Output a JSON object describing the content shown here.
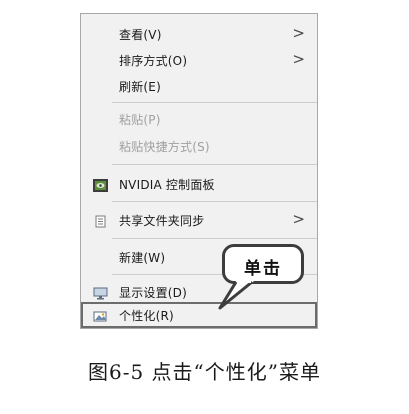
{
  "context_menu": {
    "items": [
      {
        "label": "查看(V)",
        "has_submenu": true,
        "disabled": false,
        "icon": ""
      },
      {
        "label": "排序方式(O)",
        "has_submenu": true,
        "disabled": false,
        "icon": ""
      },
      {
        "label": "刷新(E)",
        "has_submenu": false,
        "disabled": false,
        "icon": ""
      },
      {
        "label": "粘贴(P)",
        "has_submenu": false,
        "disabled": true,
        "icon": ""
      },
      {
        "label": "粘贴快捷方式(S)",
        "has_submenu": false,
        "disabled": true,
        "icon": ""
      },
      {
        "label": "NVIDIA 控制面板",
        "has_submenu": false,
        "disabled": false,
        "icon": "nvidia-icon"
      },
      {
        "label": "共享文件夹同步",
        "has_submenu": true,
        "disabled": false,
        "icon": "share-sync-icon"
      },
      {
        "label": "新建(W)",
        "has_submenu": true,
        "disabled": false,
        "icon": ""
      },
      {
        "label": "显示设置(D)",
        "has_submenu": false,
        "disabled": false,
        "icon": "display-settings-icon"
      },
      {
        "label": "个性化(R)",
        "has_submenu": false,
        "disabled": false,
        "icon": "personalize-icon",
        "highlighted": true
      }
    ],
    "submenu_glyph": ">"
  },
  "callout": {
    "text": "单击"
  },
  "caption": {
    "text": "图6-5  点击“个性化”菜单"
  }
}
